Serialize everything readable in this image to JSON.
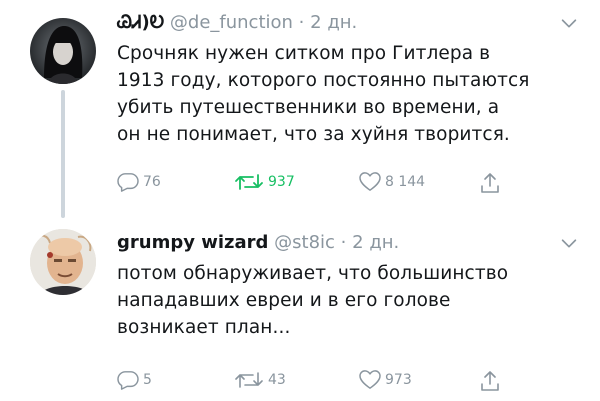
{
  "tweets": [
    {
      "display_name": "ᏊᏗ)Ꭷ",
      "handle": "@de_function",
      "separator": "·",
      "time": "2 дн.",
      "text": "Срочняк нужен ситком про Гитлера в\n1913 году, которого постоянно пытаются\nубить путешественники во времени, а\nон не понимает, что за хуйня творится.",
      "replies": "76",
      "retweets": "937",
      "likes": "8 144",
      "retweeted": true
    },
    {
      "display_name": "grumpy wizard",
      "handle": "@st8ic",
      "separator": "·",
      "time": "2 дн.",
      "text": "потом обнаруживает, что большинство\nнападавших евреи и в его голове\nвозникает план...",
      "replies": "5",
      "retweets": "43",
      "likes": "973",
      "retweeted": false
    }
  ],
  "colors": {
    "text": "#14171a",
    "secondary": "#8a959e",
    "retweet_green": "#17bf63",
    "thread_line": "#cdd5dc"
  },
  "icons": [
    "reply-icon",
    "retweet-icon",
    "like-icon",
    "share-icon",
    "chevron-down-icon"
  ]
}
